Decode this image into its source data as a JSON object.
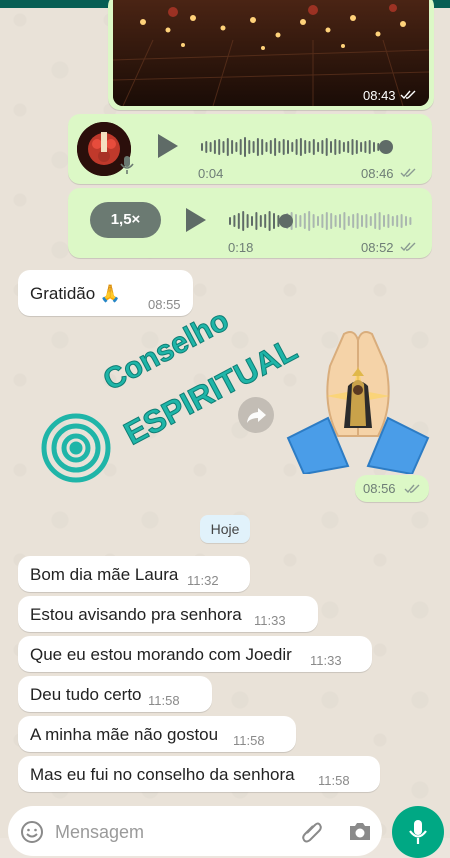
{
  "chat": {
    "image_message": {
      "time": "08:43"
    },
    "voice_message_1": {
      "duration": "0:04",
      "time": "08:46"
    },
    "voice_message_2": {
      "speed": "1,5×",
      "duration": "0:18",
      "time": "08:52"
    },
    "incoming_1": {
      "text": "Gratidão 🙏",
      "time": "08:55"
    },
    "sticker_message": {
      "time": "08:56"
    },
    "watermark": {
      "line1": "Conselho",
      "line2": "ESPIRITUAL"
    },
    "date_divider": "Hoje",
    "incoming_messages": [
      {
        "text": "Bom dia mãe Laura",
        "time": "11:32"
      },
      {
        "text": "Estou avisando pra senhora",
        "time": "11:33"
      },
      {
        "text": "Que eu estou morando com Joedir",
        "time": "11:33"
      },
      {
        "text": "Deu tudo certo",
        "time": "11:58"
      },
      {
        "text": "A minha mãe não gostou",
        "time": "11:58"
      },
      {
        "text": "Mas eu  fui no conselho da senhora",
        "time": "11:58"
      }
    ]
  },
  "composer": {
    "placeholder": "Mensagem"
  },
  "colors": {
    "outgoing_bubble": "#dcf8c6",
    "incoming_bubble": "#ffffff",
    "accent": "#00a884",
    "watermark": "#1fb5a8"
  }
}
